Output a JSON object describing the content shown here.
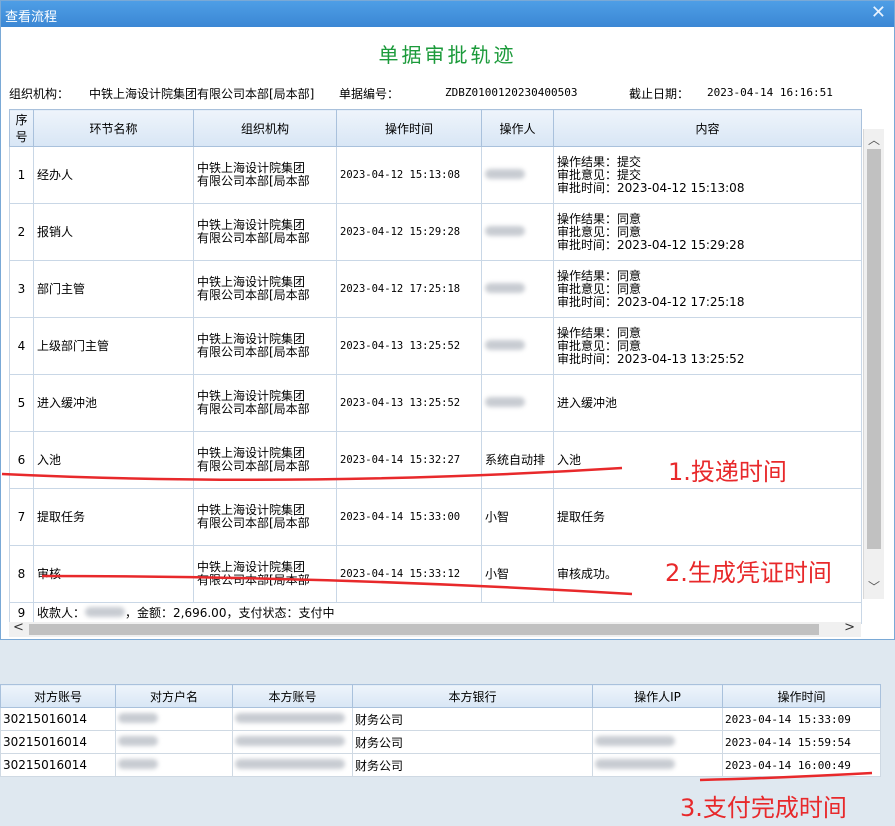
{
  "window": {
    "title": "查看流程"
  },
  "heading": "单据审批轨迹",
  "info": {
    "org_label": "组织机构：",
    "org_value": "中铁上海设计院集团有限公司本部[局本部]",
    "docno_label": "单据编号：",
    "docno_value": "ZDBZ0100120230400503",
    "date_label": "截止日期：",
    "date_value": "2023-04-14 16:16:51"
  },
  "columns": [
    "序号",
    "环节名称",
    "组织机构",
    "操作时间",
    "操作人",
    "内容"
  ],
  "rows": [
    {
      "no": "1",
      "step": "经办人",
      "org1": "中铁上海设计院集团",
      "org2": "有限公司本部[局本部",
      "time": "2023-04-12 15:13:08",
      "operator": "",
      "c1": "操作结果：提交",
      "c2": "审批意见：提交",
      "c3": "审批时间：2023-04-12 15:13:08"
    },
    {
      "no": "2",
      "step": "报销人",
      "org1": "中铁上海设计院集团",
      "org2": "有限公司本部[局本部",
      "time": "2023-04-12 15:29:28",
      "operator": "",
      "c1": "操作结果：同意",
      "c2": "审批意见：同意",
      "c3": "审批时间：2023-04-12 15:29:28"
    },
    {
      "no": "3",
      "step": "部门主管",
      "org1": "中铁上海设计院集团",
      "org2": "有限公司本部[局本部",
      "time": "2023-04-12 17:25:18",
      "operator": "",
      "c1": "操作结果：同意",
      "c2": "审批意见：同意",
      "c3": "审批时间：2023-04-12 17:25:18"
    },
    {
      "no": "4",
      "step": "上级部门主管",
      "org1": "中铁上海设计院集团",
      "org2": "有限公司本部[局本部",
      "time": "2023-04-13 13:25:52",
      "operator": "",
      "c1": "操作结果：同意",
      "c2": "审批意见：同意",
      "c3": "审批时间：2023-04-13 13:25:52"
    },
    {
      "no": "5",
      "step": "进入缓冲池",
      "org1": "中铁上海设计院集团",
      "org2": "有限公司本部[局本部",
      "time": "2023-04-13 13:25:52",
      "operator": "",
      "c1": "进入缓冲池",
      "c2": "",
      "c3": ""
    },
    {
      "no": "6",
      "step": "入池",
      "org1": "中铁上海设计院集团",
      "org2": "有限公司本部[局本部",
      "time": "2023-04-14 15:32:27",
      "operator": "系统自动排",
      "c1": "入池",
      "c2": "",
      "c3": ""
    },
    {
      "no": "7",
      "step": "提取任务",
      "org1": "中铁上海设计院集团",
      "org2": "有限公司本部[局本部",
      "time": "2023-04-14 15:33:00",
      "operator": "小智",
      "c1": "提取任务",
      "c2": "",
      "c3": ""
    },
    {
      "no": "8",
      "step": "审核",
      "org1": "中铁上海设计院集团",
      "org2": "有限公司本部[局本部",
      "time": "2023-04-14 15:33:12",
      "operator": "小智",
      "c1": "审核成功。",
      "c2": "",
      "c3": ""
    }
  ],
  "row9": {
    "no": "9",
    "payee_label": "收款人：",
    "amount": "，金额：2,696.00，支付状态：支付中"
  },
  "bottom": {
    "columns": [
      "对方账号",
      "对方户名",
      "本方账号",
      "本方银行",
      "操作人IP",
      "操作时间"
    ],
    "rows": [
      {
        "acct": "30215016014",
        "bank": "财务公司",
        "time": "2023-04-14 15:33:09"
      },
      {
        "acct": "30215016014",
        "bank": "财务公司",
        "time": "2023-04-14 15:59:54"
      },
      {
        "acct": "30215016014",
        "bank": "财务公司",
        "time": "2023-04-14 16:00:49"
      }
    ]
  },
  "annotations": {
    "a1": "1.投递时间",
    "a2": "2.生成凭证时间",
    "a3": "3.支付完成时间",
    "color": "#e8292b"
  }
}
